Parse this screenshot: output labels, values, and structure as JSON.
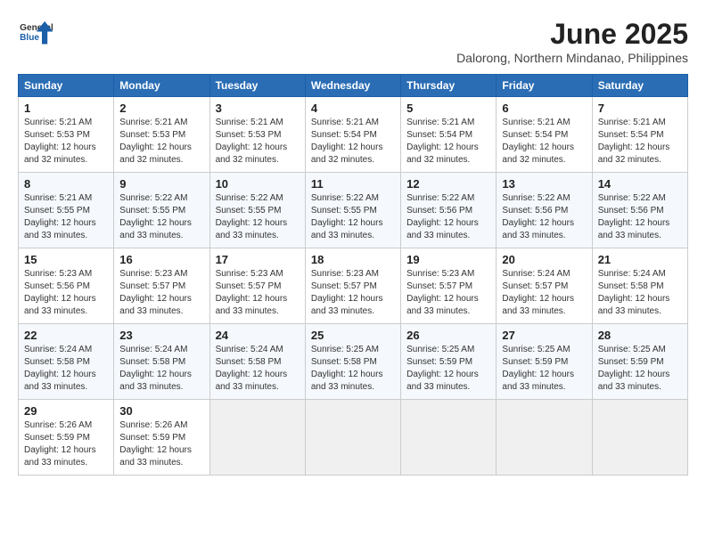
{
  "header": {
    "logo": {
      "general": "General",
      "blue": "Blue"
    },
    "title": "June 2025",
    "subtitle": "Dalorong, Northern Mindanao, Philippines"
  },
  "calendar": {
    "days_of_week": [
      "Sunday",
      "Monday",
      "Tuesday",
      "Wednesday",
      "Thursday",
      "Friday",
      "Saturday"
    ],
    "weeks": [
      {
        "row_bg": "white",
        "days": [
          {
            "num": "1",
            "sunrise": "5:21 AM",
            "sunset": "5:53 PM",
            "daylight": "12 hours and 32 minutes."
          },
          {
            "num": "2",
            "sunrise": "5:21 AM",
            "sunset": "5:53 PM",
            "daylight": "12 hours and 32 minutes."
          },
          {
            "num": "3",
            "sunrise": "5:21 AM",
            "sunset": "5:53 PM",
            "daylight": "12 hours and 32 minutes."
          },
          {
            "num": "4",
            "sunrise": "5:21 AM",
            "sunset": "5:54 PM",
            "daylight": "12 hours and 32 minutes."
          },
          {
            "num": "5",
            "sunrise": "5:21 AM",
            "sunset": "5:54 PM",
            "daylight": "12 hours and 32 minutes."
          },
          {
            "num": "6",
            "sunrise": "5:21 AM",
            "sunset": "5:54 PM",
            "daylight": "12 hours and 32 minutes."
          },
          {
            "num": "7",
            "sunrise": "5:21 AM",
            "sunset": "5:54 PM",
            "daylight": "12 hours and 32 minutes."
          }
        ]
      },
      {
        "row_bg": "alt",
        "days": [
          {
            "num": "8",
            "sunrise": "5:21 AM",
            "sunset": "5:55 PM",
            "daylight": "12 hours and 33 minutes."
          },
          {
            "num": "9",
            "sunrise": "5:22 AM",
            "sunset": "5:55 PM",
            "daylight": "12 hours and 33 minutes."
          },
          {
            "num": "10",
            "sunrise": "5:22 AM",
            "sunset": "5:55 PM",
            "daylight": "12 hours and 33 minutes."
          },
          {
            "num": "11",
            "sunrise": "5:22 AM",
            "sunset": "5:55 PM",
            "daylight": "12 hours and 33 minutes."
          },
          {
            "num": "12",
            "sunrise": "5:22 AM",
            "sunset": "5:56 PM",
            "daylight": "12 hours and 33 minutes."
          },
          {
            "num": "13",
            "sunrise": "5:22 AM",
            "sunset": "5:56 PM",
            "daylight": "12 hours and 33 minutes."
          },
          {
            "num": "14",
            "sunrise": "5:22 AM",
            "sunset": "5:56 PM",
            "daylight": "12 hours and 33 minutes."
          }
        ]
      },
      {
        "row_bg": "white",
        "days": [
          {
            "num": "15",
            "sunrise": "5:23 AM",
            "sunset": "5:56 PM",
            "daylight": "12 hours and 33 minutes."
          },
          {
            "num": "16",
            "sunrise": "5:23 AM",
            "sunset": "5:57 PM",
            "daylight": "12 hours and 33 minutes."
          },
          {
            "num": "17",
            "sunrise": "5:23 AM",
            "sunset": "5:57 PM",
            "daylight": "12 hours and 33 minutes."
          },
          {
            "num": "18",
            "sunrise": "5:23 AM",
            "sunset": "5:57 PM",
            "daylight": "12 hours and 33 minutes."
          },
          {
            "num": "19",
            "sunrise": "5:23 AM",
            "sunset": "5:57 PM",
            "daylight": "12 hours and 33 minutes."
          },
          {
            "num": "20",
            "sunrise": "5:24 AM",
            "sunset": "5:57 PM",
            "daylight": "12 hours and 33 minutes."
          },
          {
            "num": "21",
            "sunrise": "5:24 AM",
            "sunset": "5:58 PM",
            "daylight": "12 hours and 33 minutes."
          }
        ]
      },
      {
        "row_bg": "alt",
        "days": [
          {
            "num": "22",
            "sunrise": "5:24 AM",
            "sunset": "5:58 PM",
            "daylight": "12 hours and 33 minutes."
          },
          {
            "num": "23",
            "sunrise": "5:24 AM",
            "sunset": "5:58 PM",
            "daylight": "12 hours and 33 minutes."
          },
          {
            "num": "24",
            "sunrise": "5:24 AM",
            "sunset": "5:58 PM",
            "daylight": "12 hours and 33 minutes."
          },
          {
            "num": "25",
            "sunrise": "5:25 AM",
            "sunset": "5:58 PM",
            "daylight": "12 hours and 33 minutes."
          },
          {
            "num": "26",
            "sunrise": "5:25 AM",
            "sunset": "5:59 PM",
            "daylight": "12 hours and 33 minutes."
          },
          {
            "num": "27",
            "sunrise": "5:25 AM",
            "sunset": "5:59 PM",
            "daylight": "12 hours and 33 minutes."
          },
          {
            "num": "28",
            "sunrise": "5:25 AM",
            "sunset": "5:59 PM",
            "daylight": "12 hours and 33 minutes."
          }
        ]
      },
      {
        "row_bg": "white",
        "days": [
          {
            "num": "29",
            "sunrise": "5:26 AM",
            "sunset": "5:59 PM",
            "daylight": "12 hours and 33 minutes."
          },
          {
            "num": "30",
            "sunrise": "5:26 AM",
            "sunset": "5:59 PM",
            "daylight": "12 hours and 33 minutes."
          },
          {
            "num": "",
            "sunrise": "",
            "sunset": "",
            "daylight": ""
          },
          {
            "num": "",
            "sunrise": "",
            "sunset": "",
            "daylight": ""
          },
          {
            "num": "",
            "sunrise": "",
            "sunset": "",
            "daylight": ""
          },
          {
            "num": "",
            "sunrise": "",
            "sunset": "",
            "daylight": ""
          },
          {
            "num": "",
            "sunrise": "",
            "sunset": "",
            "daylight": ""
          }
        ]
      }
    ]
  }
}
